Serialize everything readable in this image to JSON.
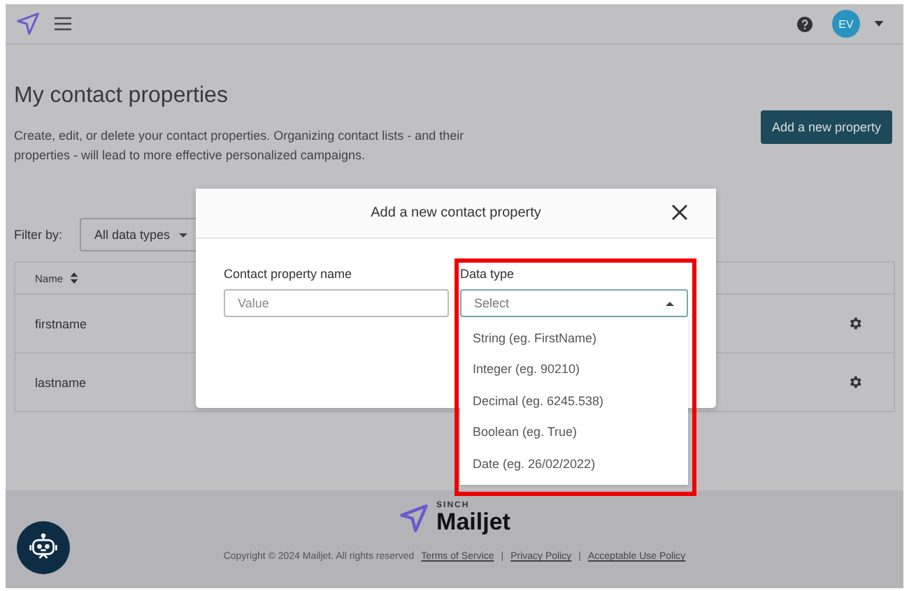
{
  "header": {
    "avatar_initials": "EV"
  },
  "page": {
    "title": "My contact properties",
    "description": "Create, edit, or delete your contact properties. Organizing contact lists - and their properties - will lead to more effective personalized campaigns.",
    "add_button": "Add a new property"
  },
  "filter": {
    "label": "Filter by:",
    "value": "All data types"
  },
  "table": {
    "columns": [
      "Name"
    ],
    "rows": [
      {
        "name": "firstname"
      },
      {
        "name": "lastname"
      }
    ]
  },
  "modal": {
    "title": "Add a new contact property",
    "fields": [
      {
        "label": "Contact property name",
        "placeholder": "Value",
        "kind": "input"
      },
      {
        "label": "Data type",
        "placeholder": "Select",
        "kind": "select",
        "expanded": true,
        "highlighted": true
      }
    ],
    "options": [
      "String (eg. FirstName)",
      "Integer (eg. 90210)",
      "Decimal (eg. 6245.538)",
      "Boolean (eg. True)",
      "Date (eg. 26/02/2022)"
    ]
  },
  "footer": {
    "brand_top": "SINCH",
    "brand": "Mailjet",
    "copyright": "Copyright © 2024 Mailjet. All rights reserved",
    "links": [
      "Terms of Service",
      "Privacy Policy",
      "Acceptable Use Policy"
    ],
    "separators": [
      "|",
      "|"
    ]
  }
}
